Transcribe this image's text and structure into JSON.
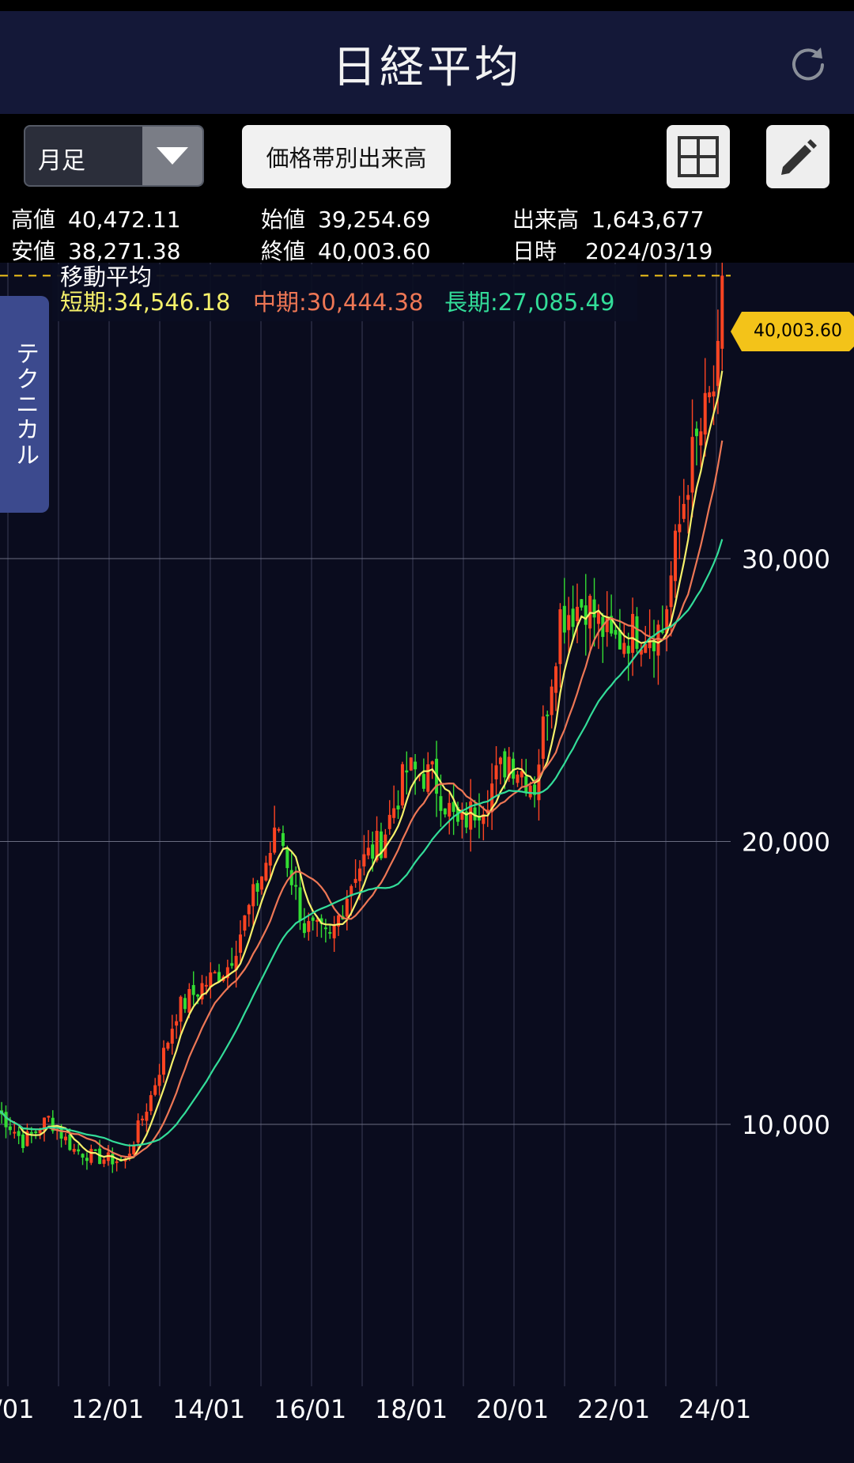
{
  "header": {
    "title": "日経平均"
  },
  "toolbar": {
    "period": "月足",
    "volume_button": "価格帯別出来高"
  },
  "stats": {
    "high_label": "高値",
    "high": "40,472.11",
    "low_label": "安値",
    "low": "38,271.38",
    "open_label": "始値",
    "open": "39,254.69",
    "close_label": "終値",
    "close": "40,003.60",
    "volume_label": "出来高",
    "volume": "1,643,677",
    "date_label": "日時",
    "date": "2024/03/19"
  },
  "technical_tab": "テクニカル",
  "ma_legend": {
    "title": "移動平均",
    "short_label": "短期",
    "short_value": "34,546.18",
    "mid_label": "中期",
    "mid_value": "30,444.38",
    "long_label": "長期",
    "long_value": "27,085.49"
  },
  "colors": {
    "up": "#ff4422",
    "down": "#33dd33",
    "short_ma": "#f5f06a",
    "mid_ma": "#ee7755",
    "long_ma": "#33dd99",
    "price_tag": "#f3c319"
  },
  "chart_data": {
    "type": "candlestick",
    "y_ticks": [
      10000,
      20000,
      30000
    ],
    "x_ticks": [
      "/01",
      "12/01",
      "14/01",
      "16/01",
      "18/01",
      "20/01",
      "22/01",
      "24/01"
    ],
    "last_price": 40003.6,
    "last_price_label": "40,003.60",
    "y_range": [
      8000,
      43500
    ],
    "grid": true,
    "close_by_year": [
      [
        "2010/01",
        10500
      ],
      [
        "2010/07",
        9400
      ],
      [
        "2011/01",
        10200
      ],
      [
        "2011/07",
        9100
      ],
      [
        "2012/01",
        8800
      ],
      [
        "2012/07",
        8700
      ],
      [
        "2013/01",
        11000
      ],
      [
        "2013/07",
        14000
      ],
      [
        "2014/01",
        14900
      ],
      [
        "2014/07",
        15600
      ],
      [
        "2015/01",
        18000
      ],
      [
        "2015/07",
        20500
      ],
      [
        "2016/01",
        17000
      ],
      [
        "2016/07",
        16500
      ],
      [
        "2017/01",
        19000
      ],
      [
        "2017/07",
        20000
      ],
      [
        "2018/01",
        22500
      ],
      [
        "2018/07",
        22300
      ],
      [
        "2019/01",
        20500
      ],
      [
        "2019/07",
        21500
      ],
      [
        "2020/01",
        23000
      ],
      [
        "2020/07",
        22000
      ],
      [
        "2021/01",
        28000
      ],
      [
        "2021/07",
        28500
      ],
      [
        "2022/01",
        27000
      ],
      [
        "2022/07",
        27500
      ],
      [
        "2023/01",
        27500
      ],
      [
        "2023/07",
        33000
      ],
      [
        "2024/01",
        36000
      ],
      [
        "2024/03",
        40003.6
      ]
    ]
  }
}
